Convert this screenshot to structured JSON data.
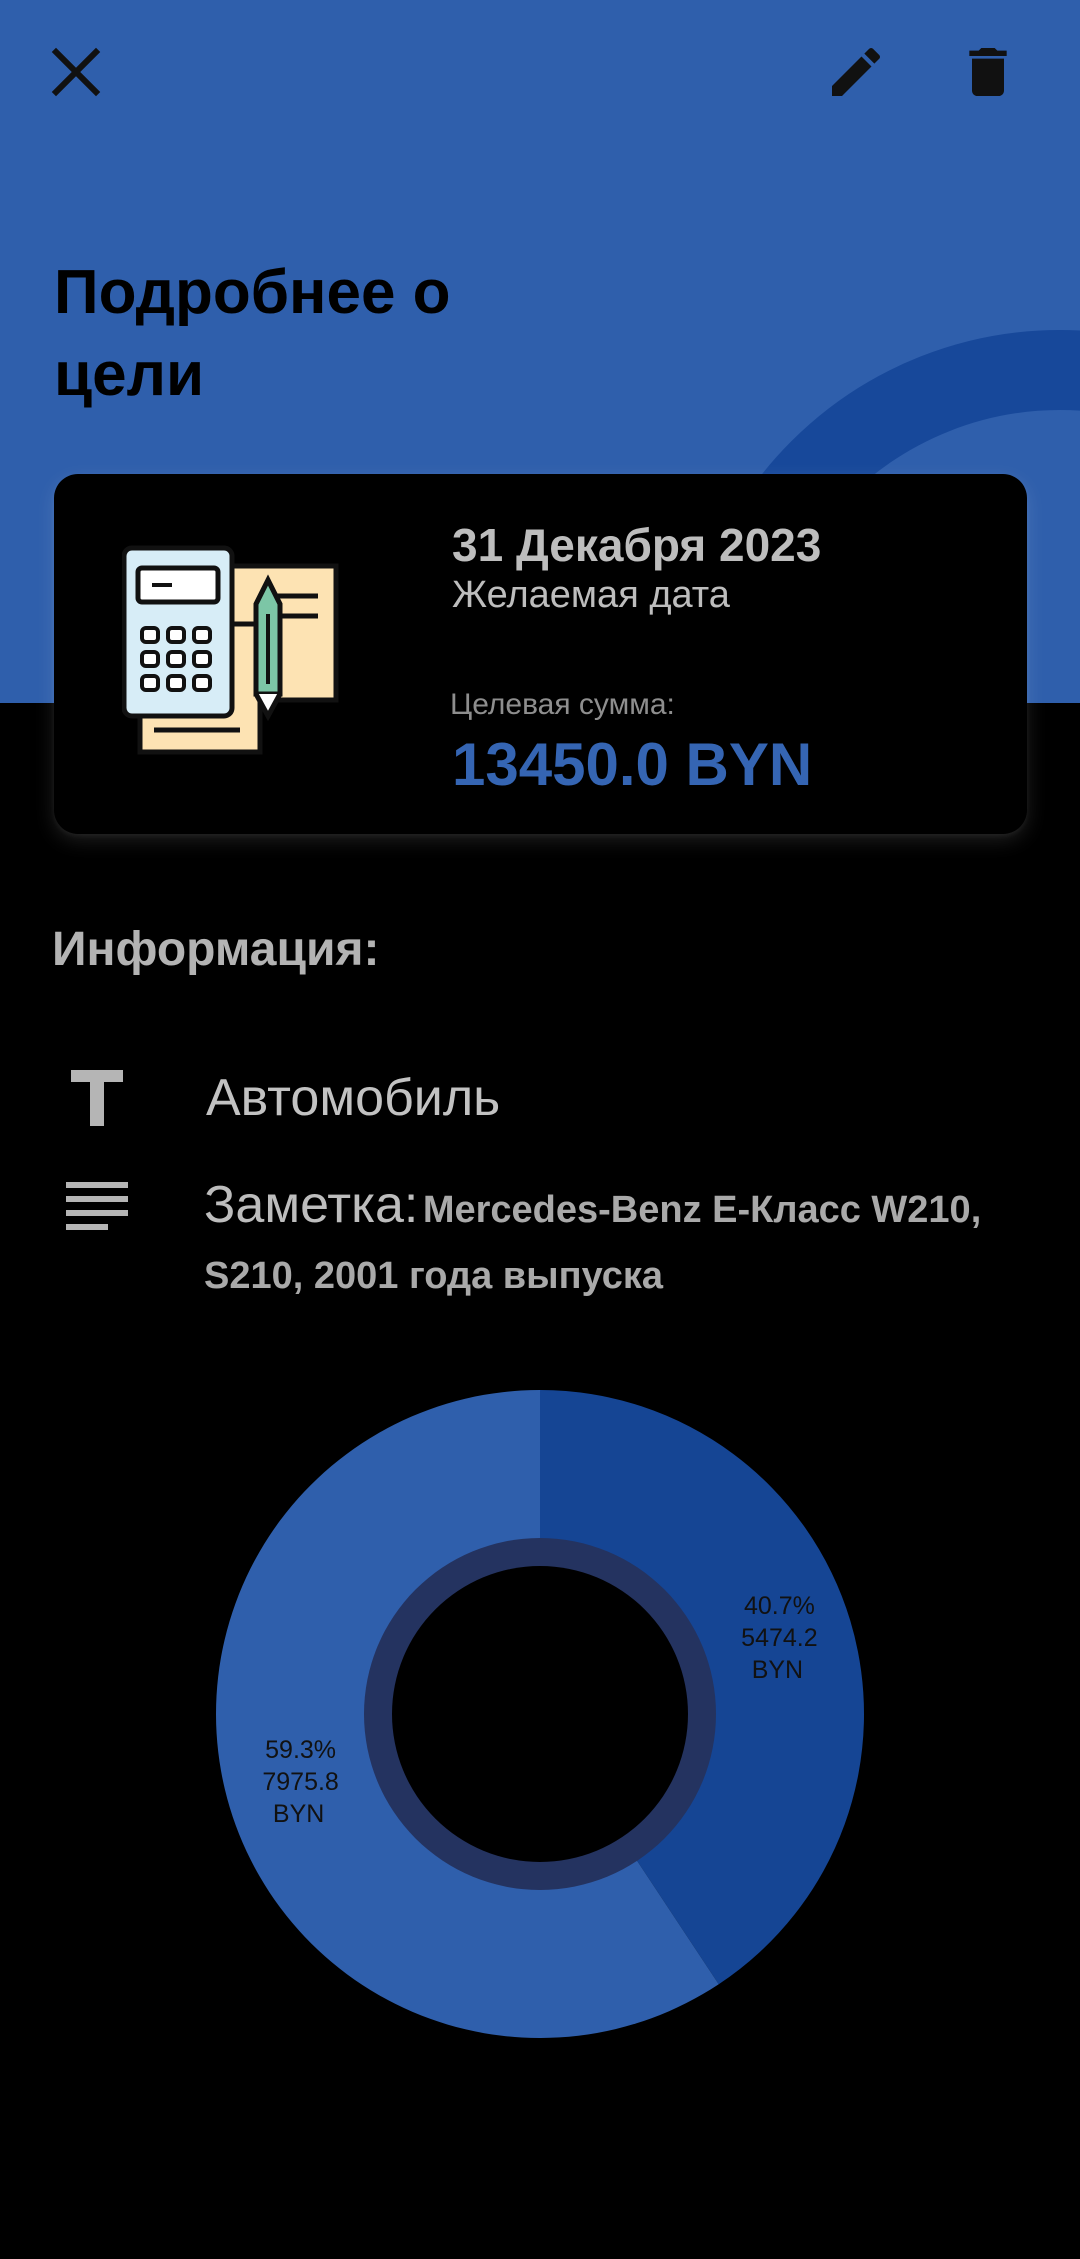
{
  "header": {
    "title": "Подробнее о цели",
    "close_icon": "close-icon",
    "edit_icon": "edit-pencil-icon",
    "delete_icon": "trash-icon",
    "background_color": "#2f5fac"
  },
  "goal_card": {
    "date": "31 Декабря 2023",
    "date_label": "Желаемая дата",
    "amount_label": "Целевая сумма:",
    "amount": "13450.0 BYN",
    "illustration": "calculator-document-icon"
  },
  "info": {
    "heading": "Информация:",
    "title_icon": "text-title-icon",
    "name": "Автомобиль",
    "notes_icon": "notes-lines-icon",
    "note_label": "Заметка:",
    "note_text": "Mercedes-Benz E-Класс W210, S210, 2001 года выпуска"
  },
  "chart_data": {
    "type": "pie",
    "style": "donut",
    "slices": [
      {
        "percent_label": "40.7%",
        "value_label": "5474.2",
        "unit": "BYN",
        "value": 5474.2,
        "color": "#154594"
      },
      {
        "percent_label": "59.3%",
        "value_label": "7975.8",
        "unit": "BYN",
        "value": 7975.8,
        "color": "#2f5fac"
      }
    ]
  },
  "colors": {
    "accent": "#3565b3",
    "card_background": "#000000",
    "page_background": "#000000"
  }
}
